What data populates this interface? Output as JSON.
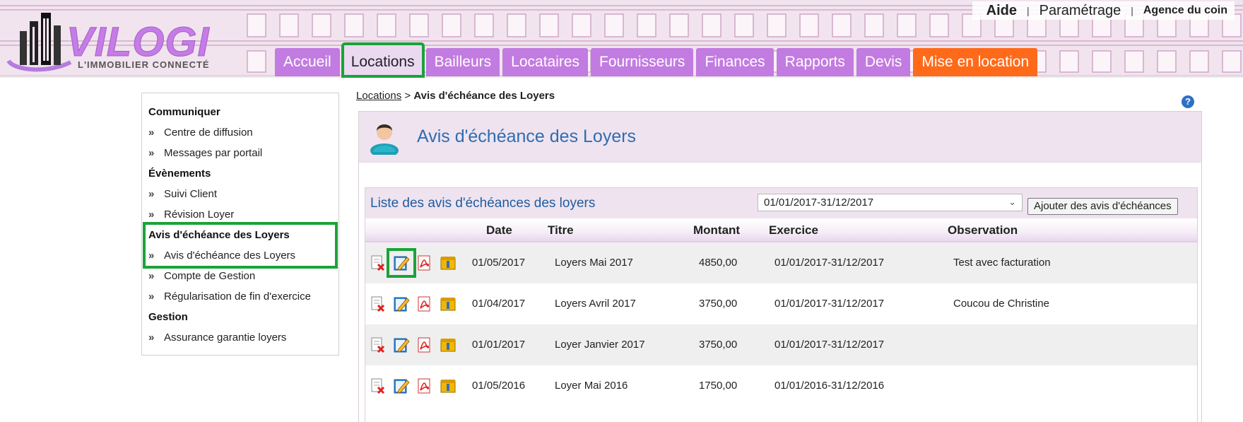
{
  "brand": {
    "name": "VILOGI",
    "tagline": "L'IMMOBILIER CONNECTÉ"
  },
  "toplinks": {
    "help": "Aide",
    "settings": "Paramétrage",
    "agency": "Agence du coin",
    "separator": "|"
  },
  "nav": {
    "tabs": [
      {
        "label": "Accueil"
      },
      {
        "label": "Locations"
      },
      {
        "label": "Bailleurs"
      },
      {
        "label": "Locataires"
      },
      {
        "label": "Fournisseurs"
      },
      {
        "label": "Finances"
      },
      {
        "label": "Rapports"
      },
      {
        "label": "Devis"
      },
      {
        "label": "Mise en location"
      }
    ]
  },
  "sidebar": {
    "groups": [
      {
        "heading": "Communiquer",
        "items": [
          "Centre de diffusion",
          "Messages par portail"
        ]
      },
      {
        "heading": "Évènements",
        "items": [
          "Suivi Client",
          "Révision Loyer"
        ]
      },
      {
        "heading": "Avis d'échéance des Loyers",
        "items": [
          "Avis d'échéance des Loyers",
          "Compte de Gestion",
          "Régularisation de fin d'exercice"
        ]
      },
      {
        "heading": "Gestion",
        "items": [
          "Assurance garantie loyers"
        ]
      }
    ],
    "chevron": "»"
  },
  "breadcrumb": {
    "parent": "Locations",
    "separator": ">",
    "current": "Avis d'échéance des Loyers"
  },
  "help_icon": "?",
  "page": {
    "title": "Avis d'échéance des Loyers"
  },
  "list": {
    "title": "Liste des avis d'échéances des loyers",
    "period_select": "01/01/2017-31/12/2017",
    "add_button": "Ajouter des avis d'échéances",
    "columns": {
      "date": "Date",
      "title": "Titre",
      "amount": "Montant",
      "exercise": "Exercice",
      "observation": "Observation"
    },
    "rows": [
      {
        "date": "01/05/2017",
        "title": "Loyers Mai 2017",
        "amount": "4850,00",
        "exercise": "01/01/2017-31/12/2017",
        "observation": "Test avec facturation"
      },
      {
        "date": "01/04/2017",
        "title": "Loyers Avril 2017",
        "amount": "3750,00",
        "exercise": "01/01/2017-31/12/2017",
        "observation": "Coucou de Christine"
      },
      {
        "date": "01/01/2017",
        "title": "Loyer Janvier 2017",
        "amount": "3750,00",
        "exercise": "01/01/2017-31/12/2017",
        "observation": ""
      },
      {
        "date": "01/05/2016",
        "title": "Loyer Mai 2016",
        "amount": "1750,00",
        "exercise": "01/01/2016-31/12/2016",
        "observation": ""
      }
    ],
    "row_actions": [
      "delete-doc-icon",
      "edit-icon",
      "pdf-icon",
      "archive-icon"
    ]
  },
  "colors": {
    "nav_purple": "#c27be0",
    "nav_orange": "#ff6a1a",
    "highlight_green": "#1aa339",
    "title_blue": "#2f6db0"
  }
}
